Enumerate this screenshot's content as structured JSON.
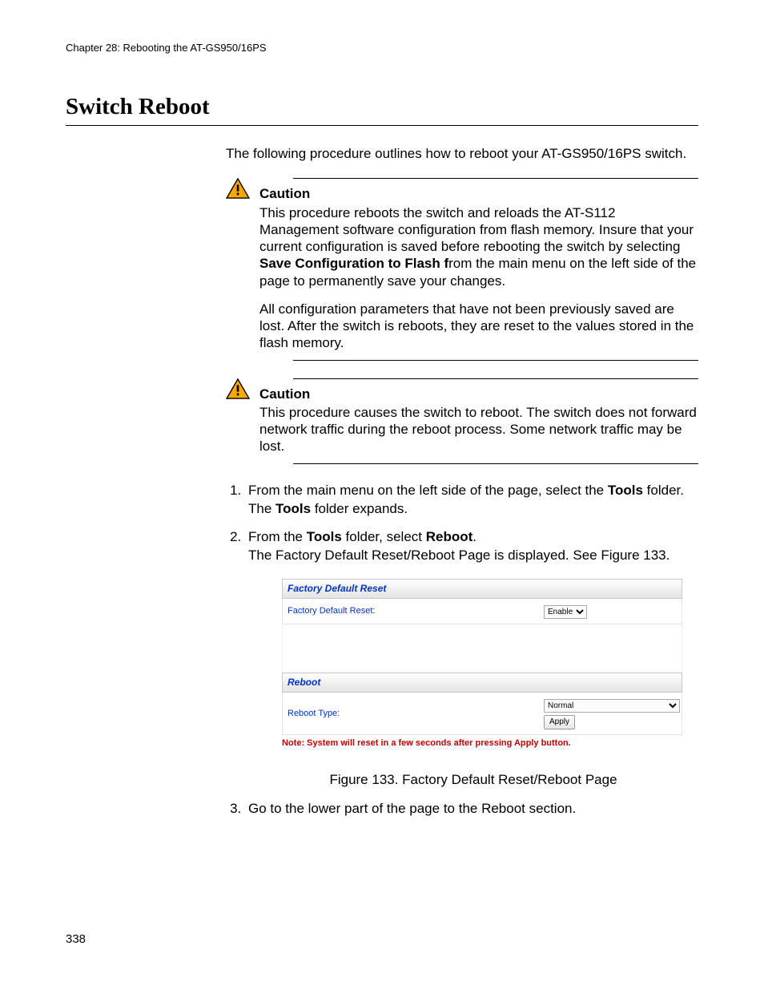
{
  "chapter_header": "Chapter 28: Rebooting the AT-GS950/16PS",
  "heading": "Switch Reboot",
  "intro": "The following procedure outlines how to reboot your AT-GS950/16PS switch.",
  "cautions": [
    {
      "label": "Caution",
      "para1_pre": "This procedure reboots the switch and reloads the AT-S112 Management software configuration from flash memory. Insure that your current configuration is saved before rebooting the switch by selecting ",
      "para1_bold": "Save Configuration to Flash f",
      "para1_post": "rom the main menu on the left side of the page to permanently save your changes.",
      "para2": "All configuration parameters that have not been previously saved are lost. After the switch is reboots, they are reset to the values stored in the flash memory."
    },
    {
      "label": "Caution",
      "text": "This procedure causes the switch to reboot. The switch does not forward network traffic during the reboot process. Some network traffic may be lost."
    }
  ],
  "steps": {
    "s1_pre": "From the main menu on the left side of the page, select the ",
    "s1_bold": "Tools",
    "s1_post": " folder.",
    "s1_sub_pre": "The ",
    "s1_sub_bold": "Tools",
    "s1_sub_post": " folder expands.",
    "s2_pre": "From the ",
    "s2_bold1": "Tools",
    "s2_mid": " folder, select ",
    "s2_bold2": "Reboot",
    "s2_post": ".",
    "s2_sub": "The Factory Default Reset/Reboot Page is displayed. See Figure 133.",
    "s3": "Go to the lower part of the page to the Reboot section."
  },
  "figure": {
    "panel1_title": "Factory Default Reset",
    "panel1_label": "Factory Default Reset:",
    "panel1_select": "Enable",
    "panel2_title": "Reboot",
    "panel2_label": "Reboot Type:",
    "panel2_select": "Normal",
    "apply_label": "Apply",
    "note": "Note: System will reset in a few seconds after pressing Apply button.",
    "caption": "Figure 133. Factory Default Reset/Reboot Page"
  },
  "page_number": "338"
}
